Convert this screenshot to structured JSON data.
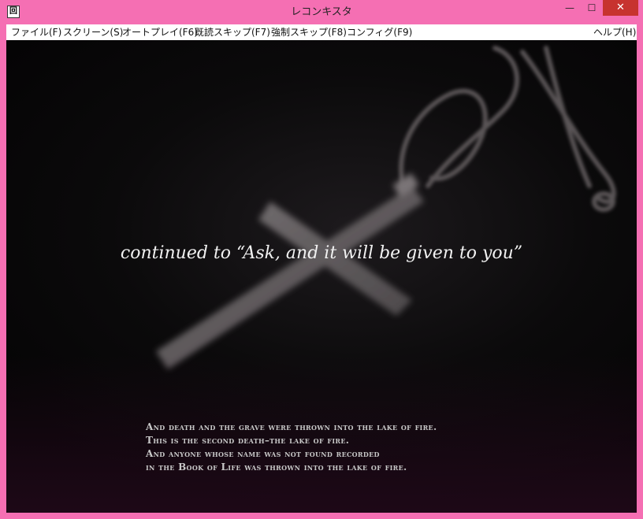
{
  "window": {
    "title": "レコンキスタ",
    "min_glyph": "—",
    "max_glyph": "☐",
    "close_glyph": "✕"
  },
  "menu": {
    "file": "ファイル(F)",
    "screen": "スクリーン(S)",
    "autoplay": "オートプレイ(F6)",
    "read_skip": "既読スキップ(F7)",
    "force_skip": "強制スキップ(F8)",
    "config": "コンフィグ(F9)",
    "help": "ヘルプ(H)"
  },
  "scene": {
    "caption": "continued to “Ask, and it will be given to you”",
    "verse": [
      "And death and the grave were thrown into the lake of fire.",
      "This is the second death–the lake of fire.",
      "And anyone whose name was not found recorded",
      " in the Book of Life was thrown into the lake of fire."
    ]
  },
  "colors": {
    "frame": "#f56fb3",
    "close": "#c7332f",
    "background": "#0b0a0b"
  }
}
